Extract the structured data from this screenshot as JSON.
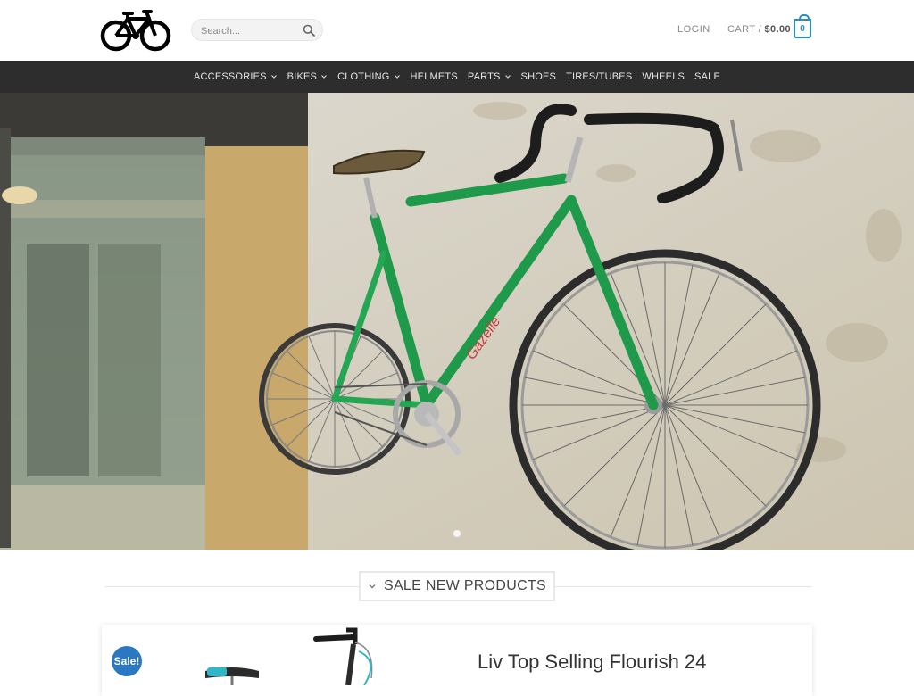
{
  "header": {
    "logo_icon": "bicycle-logo-icon",
    "search": {
      "placeholder": "Search...",
      "icon": "search-icon"
    },
    "login_label": "LOGIN",
    "cart": {
      "label": "CART /",
      "amount": "$0.00",
      "count": "0",
      "icon": "cart-bag-icon"
    }
  },
  "nav": {
    "items": [
      {
        "label": "ACCESSORIES",
        "has_dropdown": true
      },
      {
        "label": "BIKES",
        "has_dropdown": true
      },
      {
        "label": "CLOTHING",
        "has_dropdown": true
      },
      {
        "label": "HELMETS",
        "has_dropdown": false
      },
      {
        "label": "PARTS",
        "has_dropdown": true
      },
      {
        "label": "SHOES",
        "has_dropdown": false
      },
      {
        "label": "TIRES/TUBES",
        "has_dropdown": false
      },
      {
        "label": "WHEELS",
        "has_dropdown": false
      },
      {
        "label": "SALE",
        "has_dropdown": false
      }
    ]
  },
  "hero": {
    "image": "green-road-bike-on-wall",
    "frame_brand_text": "Gazelle"
  },
  "section": {
    "title": "SALE NEW PRODUCTS"
  },
  "product": {
    "badge": "Sale!",
    "title": "Liv Top Selling Flourish 24"
  },
  "colors": {
    "accent": "#2a8dc0",
    "sale_badge": "#2a78c2",
    "nav_bg": "#2d2d2d",
    "bike_frame": "#1f9a4a"
  }
}
